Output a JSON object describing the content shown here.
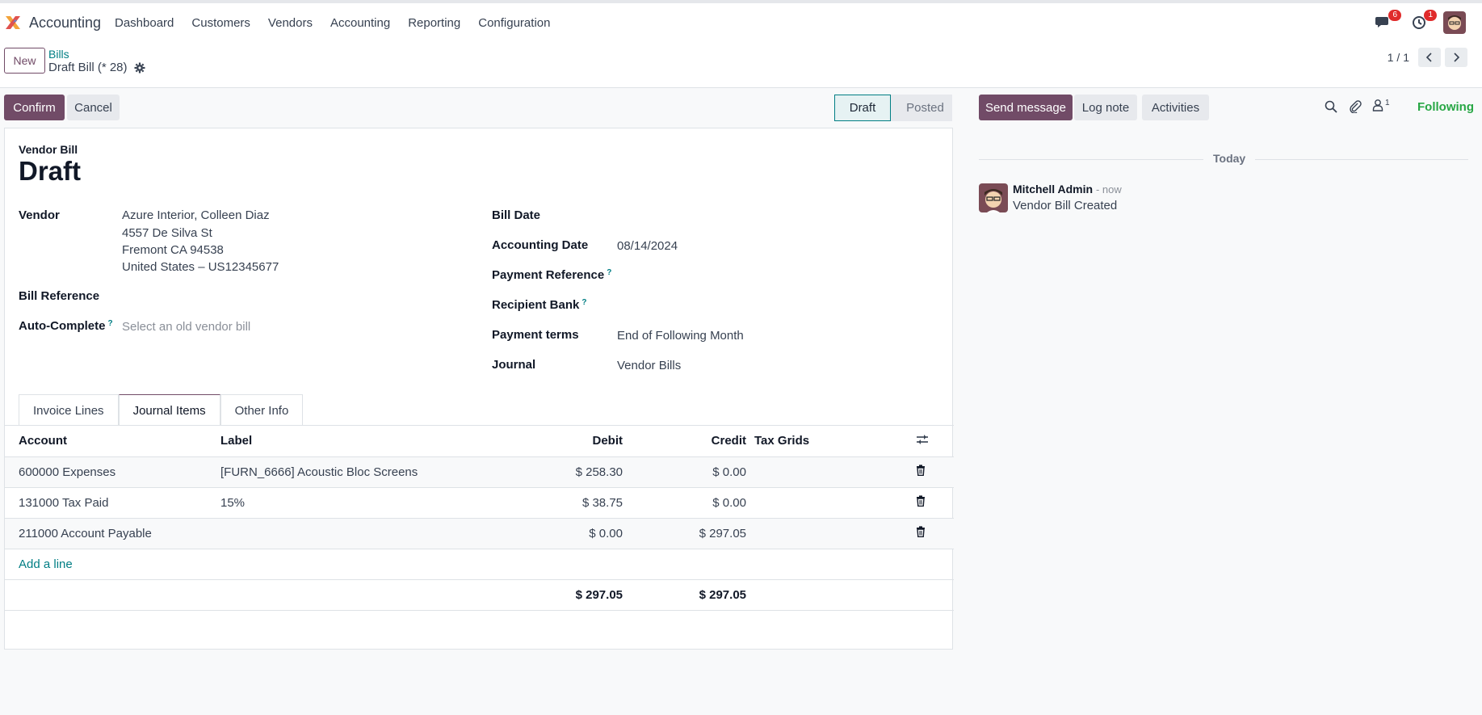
{
  "nav": {
    "app_name": "Accounting",
    "menu": [
      "Dashboard",
      "Customers",
      "Vendors",
      "Accounting",
      "Reporting",
      "Configuration"
    ],
    "messages_badge": "6",
    "activities_badge": "1"
  },
  "control": {
    "new_label": "New",
    "breadcrumb_parent": "Bills",
    "breadcrumb_current": "Draft Bill (* 28)",
    "pager": "1 / 1"
  },
  "actions": {
    "confirm": "Confirm",
    "cancel": "Cancel"
  },
  "statusbar": {
    "draft": "Draft",
    "posted": "Posted"
  },
  "form": {
    "type_label": "Vendor Bill",
    "title": "Draft",
    "vendor_label": "Vendor",
    "vendor_name": "Azure Interior, Colleen Diaz",
    "vendor_address_1": "4557 De Silva St",
    "vendor_address_2": "Fremont CA 94538",
    "vendor_address_3": "United States – US12345677",
    "bill_reference_label": "Bill Reference",
    "auto_complete_label": "Auto-Complete",
    "auto_complete_placeholder": "Select an old vendor bill",
    "bill_date_label": "Bill Date",
    "accounting_date_label": "Accounting Date",
    "accounting_date": "08/14/2024",
    "payment_reference_label": "Payment Reference",
    "recipient_bank_label": "Recipient Bank",
    "payment_terms_label": "Payment terms",
    "payment_terms": "End of Following Month",
    "journal_label": "Journal",
    "journal": "Vendor Bills",
    "help_mark": "?"
  },
  "tabs": [
    "Invoice Lines",
    "Journal Items",
    "Other Info"
  ],
  "journal_items": {
    "headers": {
      "account": "Account",
      "label": "Label",
      "debit": "Debit",
      "credit": "Credit",
      "tax_grids": "Tax Grids"
    },
    "rows": [
      {
        "account": "600000 Expenses",
        "label": "[FURN_6666] Acoustic Bloc Screens",
        "debit": "$ 258.30",
        "credit": "$ 0.00"
      },
      {
        "account": "131000 Tax Paid",
        "label": "15%",
        "debit": "$ 38.75",
        "credit": "$ 0.00"
      },
      {
        "account": "211000 Account Payable",
        "label": "",
        "debit": "$ 0.00",
        "credit": "$ 297.05"
      }
    ],
    "add_line": "Add a line",
    "total_debit": "$ 297.05",
    "total_credit": "$ 297.05"
  },
  "chatter": {
    "send_message": "Send message",
    "log_note": "Log note",
    "activities": "Activities",
    "followers_count": "1",
    "following": "Following",
    "date_separator": "Today",
    "author": "Mitchell Admin",
    "time": "- now",
    "message": "Vendor Bill Created"
  }
}
